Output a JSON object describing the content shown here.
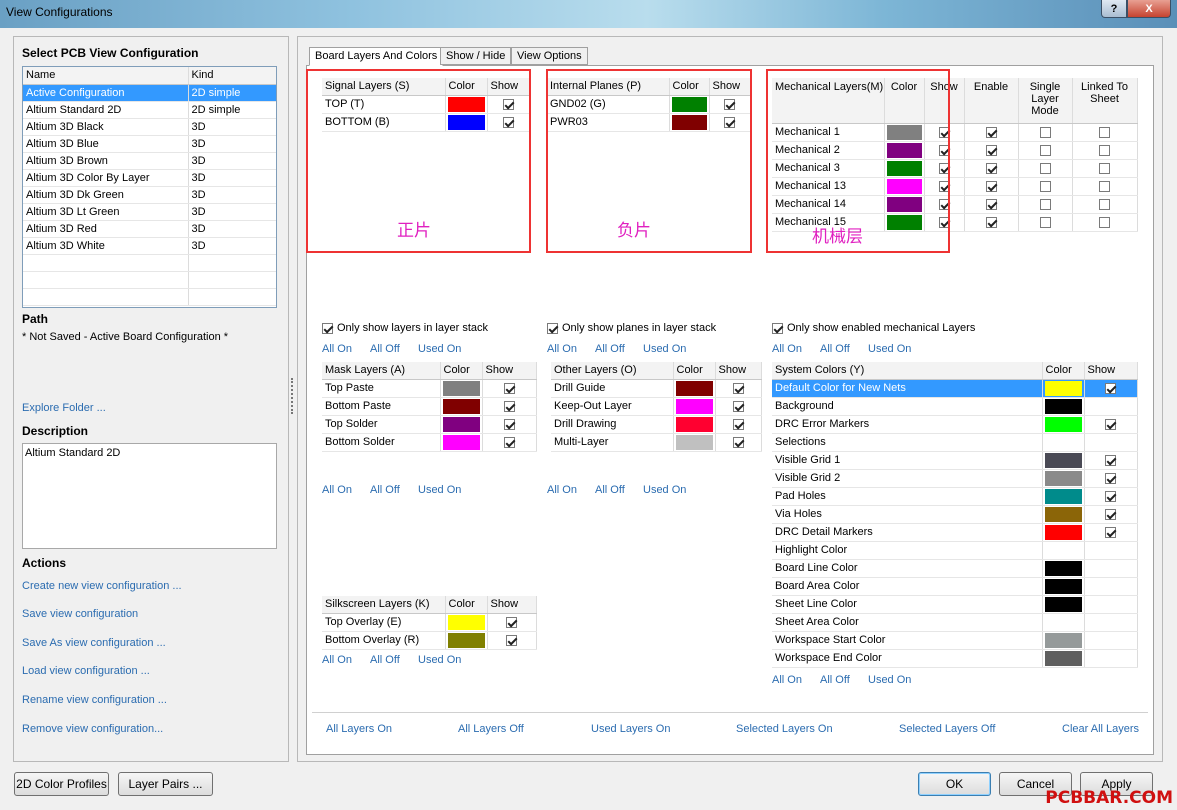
{
  "window": {
    "title": "View Configurations",
    "help": "?",
    "close": "X"
  },
  "left": {
    "select_header": "Select PCB View Configuration",
    "col_name": "Name",
    "col_kind": "Kind",
    "configs": [
      {
        "name": "Active Configuration",
        "kind": "2D simple"
      },
      {
        "name": "Altium Standard 2D",
        "kind": "2D simple"
      },
      {
        "name": "Altium 3D Black",
        "kind": "3D"
      },
      {
        "name": "Altium 3D Blue",
        "kind": "3D"
      },
      {
        "name": "Altium 3D Brown",
        "kind": "3D"
      },
      {
        "name": "Altium 3D Color By Layer",
        "kind": "3D"
      },
      {
        "name": "Altium 3D Dk Green",
        "kind": "3D"
      },
      {
        "name": "Altium 3D Lt Green",
        "kind": "3D"
      },
      {
        "name": "Altium 3D Red",
        "kind": "3D"
      },
      {
        "name": "Altium 3D White",
        "kind": "3D"
      }
    ],
    "path_header": "Path",
    "path_value": "* Not Saved - Active Board Configuration *",
    "explore": "Explore Folder ...",
    "desc_header": "Description",
    "desc_value": "Altium Standard 2D",
    "actions_header": "Actions",
    "actions": [
      "Create new view configuration ...",
      "Save view configuration",
      "Save As view configuration ...",
      "Load view configuration ...",
      "Rename view configuration ...",
      "Remove view configuration..."
    ]
  },
  "tabs": [
    "Board Layers And Colors",
    "Show / Hide",
    "View Options"
  ],
  "common": {
    "all_on": "All On",
    "all_off": "All Off",
    "used_on": "Used On",
    "color": "Color",
    "show": "Show"
  },
  "signal": {
    "title": "Signal Layers (S)",
    "rows": [
      {
        "name": "TOP (T)",
        "color": "#ff0000",
        "show": true
      },
      {
        "name": "BOTTOM (B)",
        "color": "#0000ff",
        "show": true
      }
    ],
    "annotation": "正片",
    "only_show": "Only show layers in layer stack"
  },
  "planes": {
    "title": "Internal Planes (P)",
    "rows": [
      {
        "name": "GND02 (G)",
        "color": "#008000",
        "show": true
      },
      {
        "name": "PWR03",
        "color": "#800000",
        "show": true
      }
    ],
    "annotation": "负片",
    "only_show": "Only show planes in layer stack"
  },
  "mech": {
    "title": "Mechanical Layers(M)",
    "enable": "Enable",
    "single": "Single Layer Mode",
    "linked": "Linked To Sheet",
    "rows": [
      {
        "name": "Mechanical 1",
        "color": "#808080",
        "show": true,
        "enable": true,
        "single": false,
        "linked": false
      },
      {
        "name": "Mechanical 2",
        "color": "#800080",
        "show": true,
        "enable": true,
        "single": false,
        "linked": false
      },
      {
        "name": "Mechanical 3",
        "color": "#008000",
        "show": true,
        "enable": true,
        "single": false,
        "linked": false
      },
      {
        "name": "Mechanical 13",
        "color": "#ff00ff",
        "show": true,
        "enable": true,
        "single": false,
        "linked": false
      },
      {
        "name": "Mechanical 14",
        "color": "#800080",
        "show": true,
        "enable": true,
        "single": false,
        "linked": false
      },
      {
        "name": "Mechanical 15",
        "color": "#008000",
        "show": true,
        "enable": true,
        "single": false,
        "linked": false
      }
    ],
    "annotation": "机械层",
    "only_show": "Only show enabled mechanical Layers"
  },
  "mask": {
    "title": "Mask Layers (A)",
    "rows": [
      {
        "name": "Top Paste",
        "color": "#808080",
        "show": true
      },
      {
        "name": "Bottom Paste",
        "color": "#800000",
        "show": true
      },
      {
        "name": "Top Solder",
        "color": "#800080",
        "show": true
      },
      {
        "name": "Bottom Solder",
        "color": "#ff00ff",
        "show": true
      }
    ]
  },
  "other": {
    "title": "Other Layers (O)",
    "rows": [
      {
        "name": "Drill Guide",
        "color": "#800000",
        "show": true
      },
      {
        "name": "Keep-Out Layer",
        "color": "#ff00ff",
        "show": true
      },
      {
        "name": "Drill Drawing",
        "color": "#ff0030",
        "show": true
      },
      {
        "name": "Multi-Layer",
        "color": "#c0c0c0",
        "show": true
      }
    ]
  },
  "system": {
    "title": "System Colors (Y)",
    "rows": [
      {
        "name": "Default Color for New Nets",
        "color": "#ffff00",
        "show": true,
        "has_show": true
      },
      {
        "name": "Background",
        "color": "#000000",
        "show": false,
        "has_show": false
      },
      {
        "name": "DRC Error Markers",
        "color": "#00ff00",
        "show": true,
        "has_show": true
      },
      {
        "name": "Selections",
        "color": "#ffffff",
        "show": false,
        "has_show": false
      },
      {
        "name": "Visible Grid 1",
        "color": "#4a4a55",
        "show": true,
        "has_show": true
      },
      {
        "name": "Visible Grid 2",
        "color": "#8a8a8a",
        "show": true,
        "has_show": true
      },
      {
        "name": "Pad Holes",
        "color": "#008b8b",
        "show": true,
        "has_show": true
      },
      {
        "name": "Via Holes",
        "color": "#8b6508",
        "show": true,
        "has_show": true
      },
      {
        "name": "DRC Detail Markers",
        "color": "#ff0000",
        "show": true,
        "has_show": true
      },
      {
        "name": "Highlight Color",
        "color": "#ffffff",
        "show": false,
        "has_show": false
      },
      {
        "name": "Board Line Color",
        "color": "#000000",
        "show": false,
        "has_show": false
      },
      {
        "name": "Board Area Color",
        "color": "#000000",
        "show": false,
        "has_show": false
      },
      {
        "name": "Sheet Line Color",
        "color": "#000000",
        "show": false,
        "has_show": false
      },
      {
        "name": "Sheet Area Color",
        "color": "#ffffff",
        "show": false,
        "has_show": false
      },
      {
        "name": "Workspace Start Color",
        "color": "#959a9a",
        "show": false,
        "has_show": false
      },
      {
        "name": "Workspace End Color",
        "color": "#5f5f5f",
        "show": false,
        "has_show": false
      }
    ]
  },
  "silk": {
    "title": "Silkscreen Layers (K)",
    "rows": [
      {
        "name": "Top Overlay (E)",
        "color": "#ffff00",
        "show": true
      },
      {
        "name": "Bottom Overlay (R)",
        "color": "#808000",
        "show": true
      }
    ]
  },
  "bottom_links": [
    "All Layers On",
    "All Layers Off",
    "Used Layers On",
    "Selected Layers On",
    "Selected Layers Off",
    "Clear All Layers"
  ],
  "buttons": {
    "color_profiles": "2D Color Profiles",
    "layer_pairs": "Layer Pairs ...",
    "ok": "OK",
    "cancel": "Cancel",
    "apply": "Apply"
  },
  "watermark": "PCBBAR.COM"
}
